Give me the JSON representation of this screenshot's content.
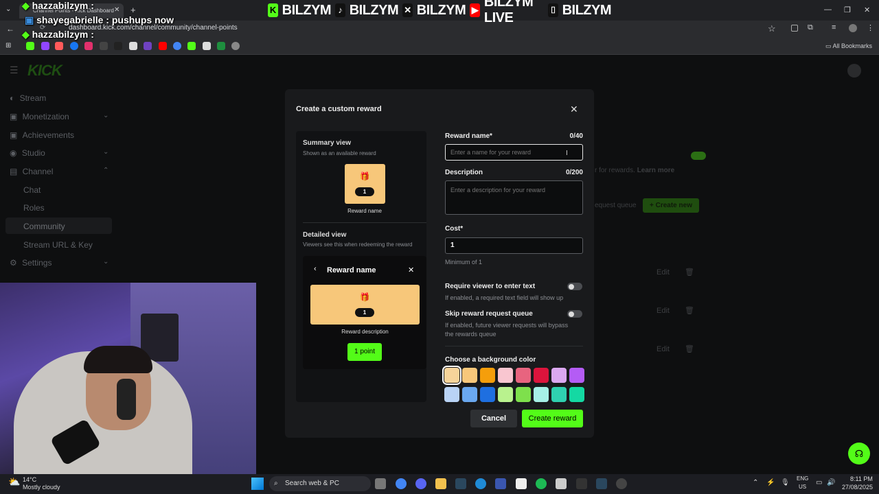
{
  "browser": {
    "tab_title": "Channel Points - Kick Dashboard",
    "url": "dashboard.kick.com/channel/community/channel-points",
    "all_bookmarks": "All Bookmarks"
  },
  "overlay": {
    "banner": [
      "BILZYM",
      "BILZYM",
      "BILZYM",
      "BILZYM LIVE",
      "BILZYM"
    ],
    "chat": [
      {
        "user": "hazzabilzym",
        "text": "hazzabilzym :"
      },
      {
        "user": "shayegabrielle",
        "text": "shayegabrielle : pushups now"
      },
      {
        "user": "hazzabilzym",
        "text": "hazzabilzym :"
      }
    ]
  },
  "sidebar": {
    "logo": "KICK",
    "items": [
      {
        "label": "Stream",
        "icon": "stream-icon"
      },
      {
        "label": "Monetization",
        "icon": "dollar-icon"
      },
      {
        "label": "Achievements",
        "icon": "trophy-icon"
      },
      {
        "label": "Studio",
        "icon": "studio-icon"
      },
      {
        "label": "Channel",
        "icon": "channel-icon"
      },
      {
        "label": "Chat"
      },
      {
        "label": "Roles"
      },
      {
        "label": "Community"
      },
      {
        "label": "Stream URL & Key"
      },
      {
        "label": "Settings",
        "icon": "gear-icon"
      }
    ]
  },
  "background": {
    "rewards_text": "r for rewards.",
    "learn_more": "Learn more",
    "request_queue": "equest queue",
    "create_new": "+ Create new",
    "edit": "Edit"
  },
  "modal": {
    "title": "Create a custom reward",
    "summary": {
      "heading": "Summary view",
      "sub": "Shown as an available reward",
      "cost": "1",
      "name": "Reward name"
    },
    "detailed": {
      "heading": "Detailed view",
      "sub": "Viewers see this when redeeming the reward",
      "title": "Reward name",
      "cost": "1",
      "description": "Reward description",
      "points_button": "1 point"
    },
    "reward_name": {
      "label": "Reward name*",
      "count": "0/40",
      "placeholder": "Enter a name for your reward"
    },
    "description": {
      "label": "Description",
      "count": "0/200",
      "placeholder": "Enter a description for your reward"
    },
    "cost": {
      "label": "Cost*",
      "value": "1",
      "hint": "Minimum of 1"
    },
    "require_text": {
      "label": "Require viewer to enter text",
      "hint": "If enabled, a required text field will show up"
    },
    "skip_queue": {
      "label": "Skip reward request queue",
      "hint1": "If enabled, future viewer requests will bypass",
      "hint2": "the rewards queue"
    },
    "bg_color": {
      "label": "Choose a background color",
      "colors": [
        "#f7d49a",
        "#f7c77a",
        "#f59e0b",
        "#f9c6d0",
        "#e8647f",
        "#dc143c",
        "#dba8f0",
        "#b45cf5",
        "#b9d3f5",
        "#6aa8ef",
        "#1e6fe0",
        "#b9f28e",
        "#7ee04c",
        "#a6f0e6",
        "#2fd1b0",
        "#14d9a3"
      ],
      "selected": 0
    },
    "cancel": "Cancel",
    "create": "Create reward"
  },
  "taskbar": {
    "weather_temp": "14°C",
    "weather_desc": "Mostly cloudy",
    "search": "Search web & PC",
    "lang1": "ENG",
    "lang2": "US",
    "time": "8:11 PM",
    "date": "27/08/2025"
  }
}
